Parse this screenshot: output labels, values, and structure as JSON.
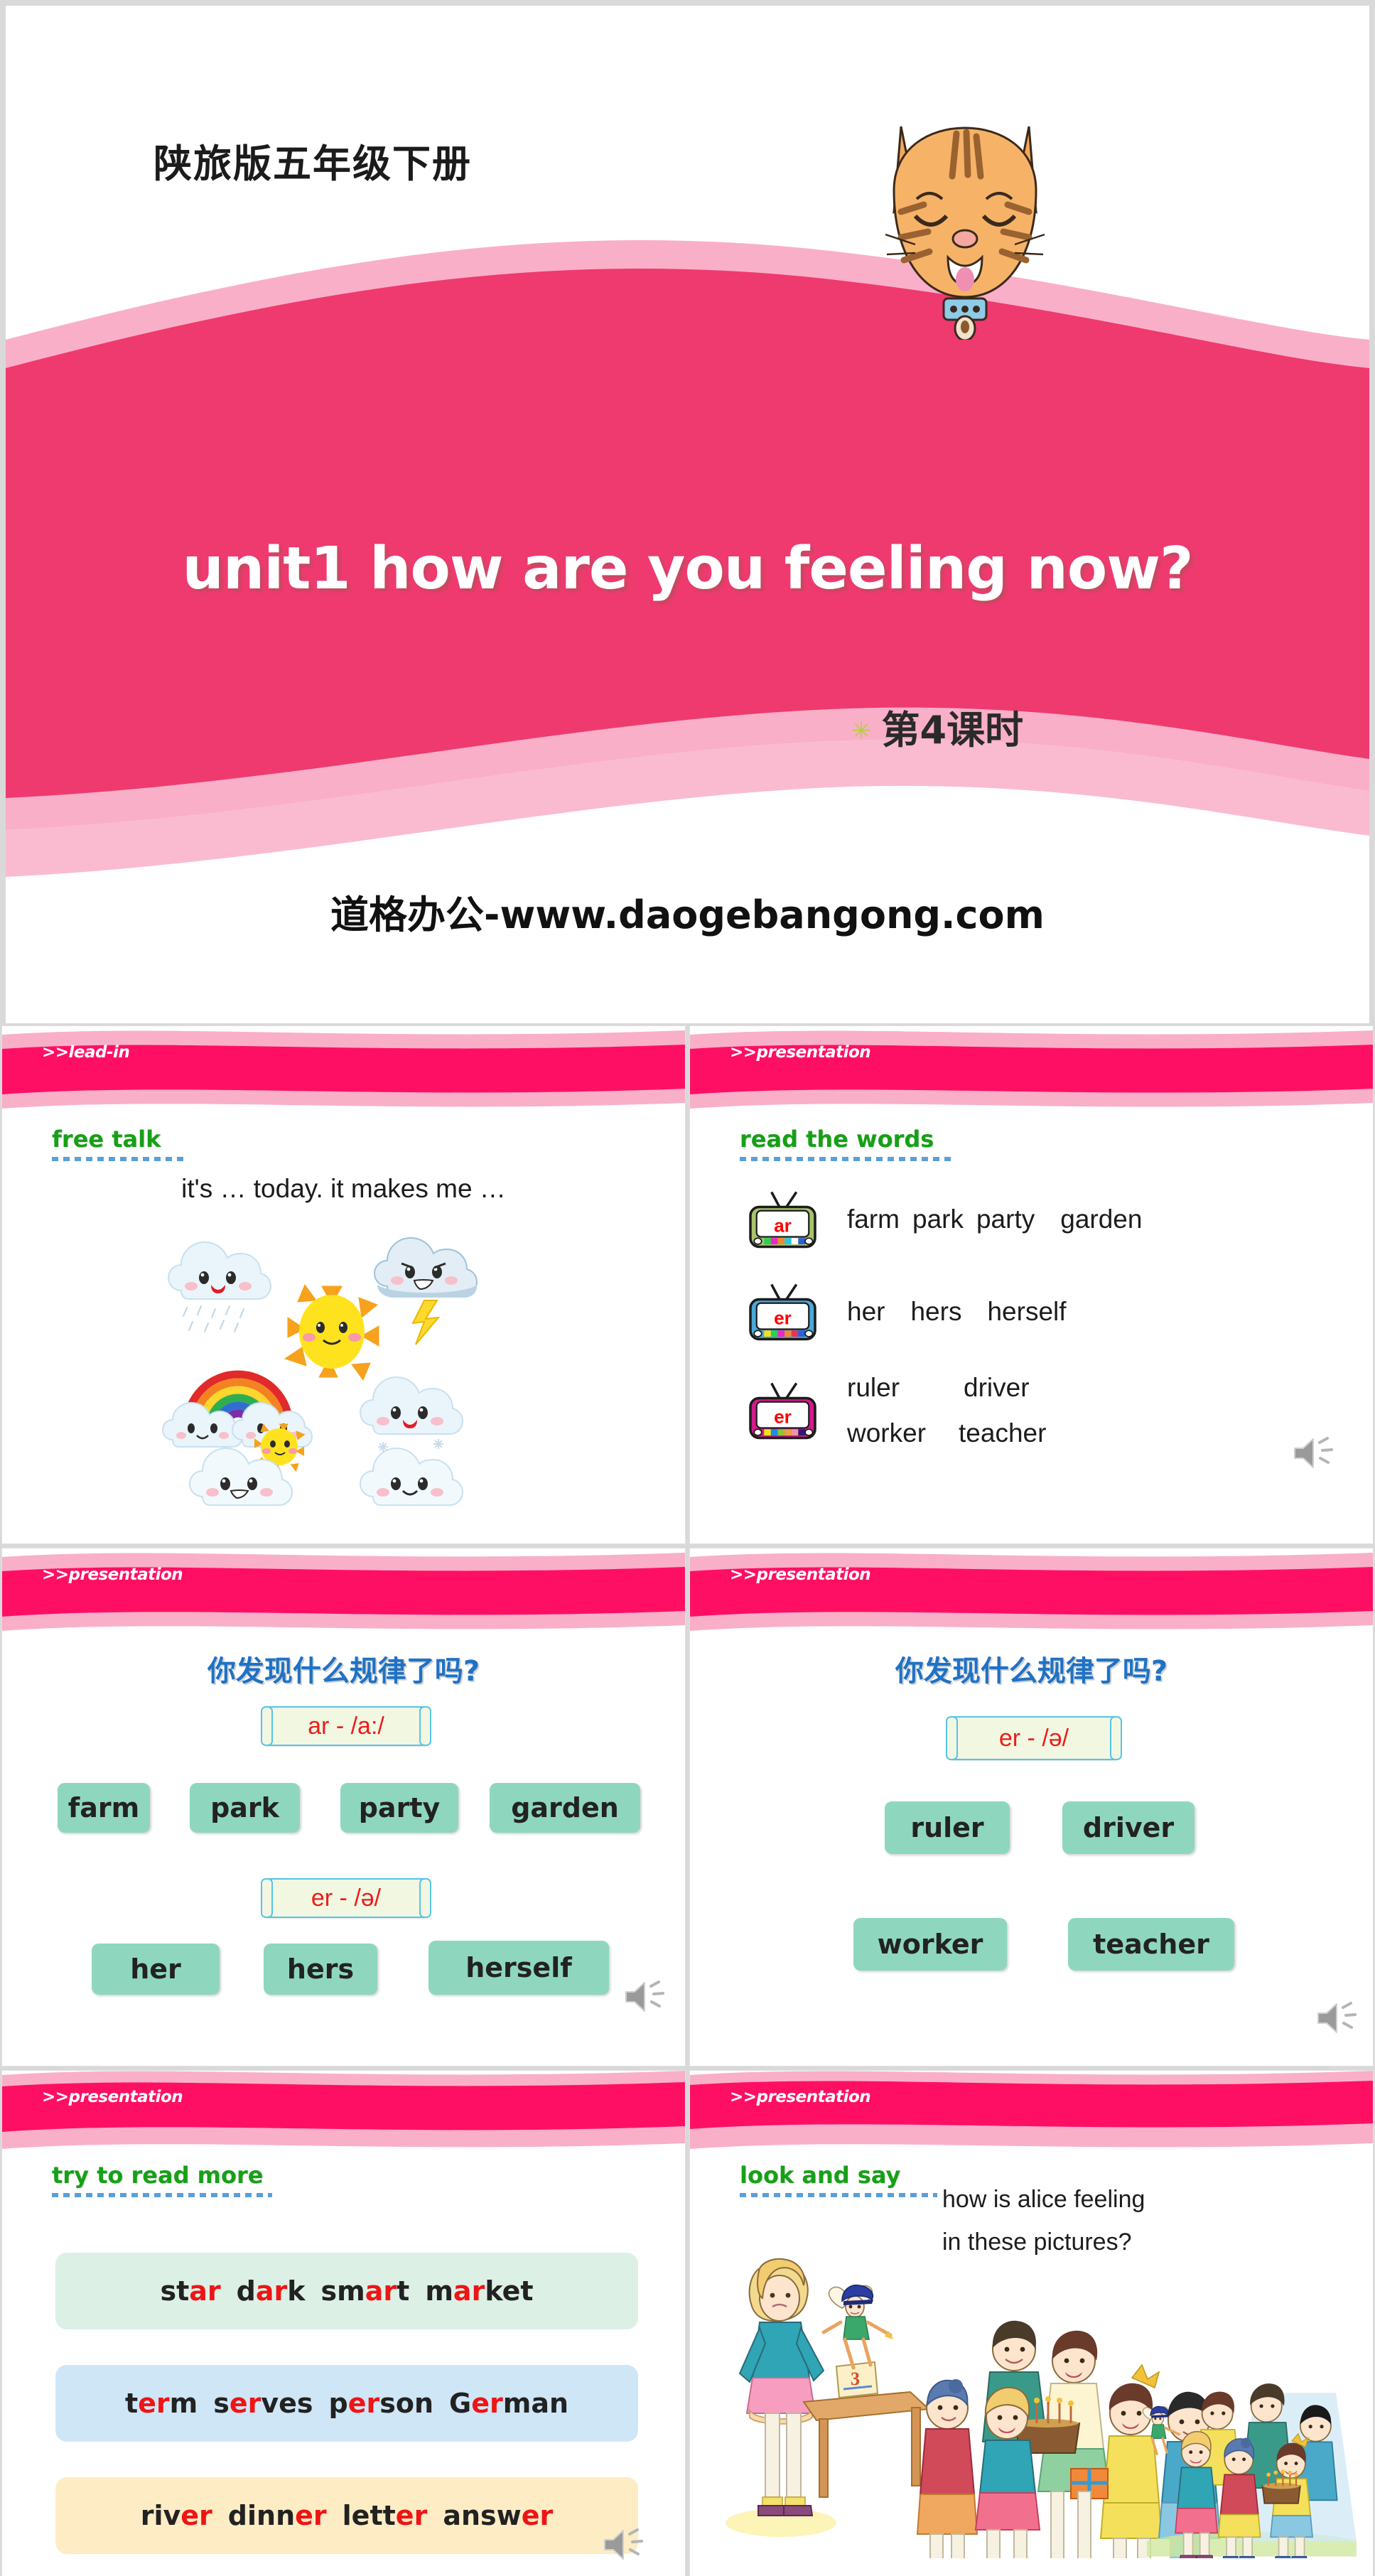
{
  "cover": {
    "book_title": "陕旅版五年级下册",
    "main_title": "unit1 how are you feeling now?",
    "star_icon": "✳",
    "lesson": "第4课时",
    "watermark": "道格办公-www.daogebangong.com",
    "cat_icon": "cat-mascot"
  },
  "colors": {
    "brand_pink": "#ee3a6f",
    "band_pink": "#ff0f63",
    "band_light_pink": "#f9afc8",
    "heading_green": "#16a016",
    "chip_green": "#8ed7be",
    "highlight_red": "#ee1515",
    "question_blue": "#1f72c4",
    "scroll_border": "#56c4e8",
    "scroll_fill": "#f2f7e2"
  },
  "slides": [
    {
      "tag": ">>lead-in",
      "heading": "free talk",
      "prompt": "it's … today. it makes me …",
      "art": "weather-faces-illustration",
      "has_speaker": false
    },
    {
      "tag": ">>presentation",
      "heading": "read the words",
      "has_speaker": true,
      "tv_rows": [
        {
          "letters": "ar",
          "frame_color": "#a8c46a",
          "swatches": [
            "#2ece53",
            "#f423c8",
            "#f08a2e",
            "#29c6ea",
            "#ffffff",
            "#2e5fd4"
          ],
          "words": [
            "farm",
            "park",
            "party",
            "garden"
          ]
        },
        {
          "letters": "er",
          "frame_color": "#4aa9d8",
          "swatches": [
            "#f4e01e",
            "#2ece53",
            "#f423c8",
            "#f08a2e",
            "#e8315f",
            "#2e5fd4"
          ],
          "words": [
            "her",
            "hers",
            "herself"
          ]
        },
        {
          "letters": "er",
          "frame_color": "#d6198c",
          "swatches": [
            "#f4e01e",
            "#1d8fe0",
            "#8cc43c",
            "#f0a03e",
            "#f292a8",
            "#3a1478"
          ],
          "words": [
            "ruler",
            "driver",
            "worker",
            "teacher"
          ]
        }
      ]
    },
    {
      "tag": ">>presentation",
      "question": "你发现什么规律了吗?",
      "has_speaker": true,
      "groups": [
        {
          "rule": "ar - /a:/",
          "words": [
            "farm",
            "park",
            "party",
            "garden"
          ]
        },
        {
          "rule": "er - /ə/",
          "words": [
            "her",
            "hers",
            "herself"
          ]
        }
      ]
    },
    {
      "tag": ">>presentation",
      "question": "你发现什么规律了吗?",
      "has_speaker": true,
      "groups": [
        {
          "rule": "er - /ə/",
          "words": [
            "ruler",
            "driver",
            "worker",
            "teacher"
          ]
        }
      ]
    },
    {
      "tag": ">>presentation",
      "heading": "try to read more",
      "has_speaker": true,
      "bars": [
        {
          "bg": "#ddf0e6",
          "words": [
            [
              "st",
              "ar",
              ""
            ],
            [
              "d",
              "ar",
              "k"
            ],
            [
              "sm",
              "ar",
              "t"
            ],
            [
              "m",
              "ar",
              "ket"
            ]
          ]
        },
        {
          "bg": "#cfe6f7",
          "words": [
            [
              "t",
              "er",
              "m"
            ],
            [
              "s",
              "er",
              "ves"
            ],
            [
              "p",
              "er",
              "son"
            ],
            [
              "G",
              "er",
              "man"
            ]
          ]
        },
        {
          "bg": "#fdecc4",
          "words": [
            [
              "riv",
              "er",
              ""
            ],
            [
              "dinn",
              "er",
              ""
            ],
            [
              "lett",
              "er",
              ""
            ],
            [
              "answ",
              "er",
              ""
            ]
          ]
        }
      ]
    },
    {
      "tag": ">>presentation",
      "heading": "look and say",
      "question_line1": "how is alice feeling",
      "question_line2": "in these pictures?",
      "art": "alice-birthday-scene",
      "has_speaker": false
    }
  ]
}
